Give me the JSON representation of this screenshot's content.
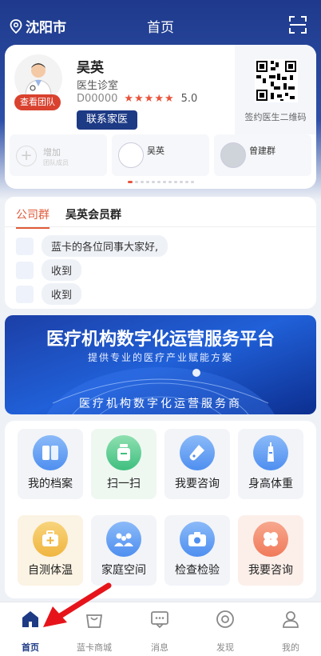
{
  "header": {
    "city": "沈阳市",
    "title": "首页"
  },
  "doctor": {
    "name": "吴英",
    "org": "医生诊室",
    "id": "D00000",
    "stars": "★★★★★",
    "rating": "5.0",
    "team_badge": "查看团队",
    "contact_button": "联系家医",
    "qr_label": "签约医生二维码"
  },
  "team": {
    "add_title": "增加",
    "add_sub": "团队成员",
    "members": [
      {
        "name": "吴英"
      },
      {
        "name": "曾建群"
      }
    ]
  },
  "groups": {
    "tabs": [
      "公司群",
      "吴英会员群"
    ],
    "messages": [
      "蓝卡的各位同事大家好,",
      "收到",
      "收到"
    ]
  },
  "banner": {
    "title": "医疗机构数字化运营服务平台",
    "subtitle": "提供专业的医疗产业赋能方案",
    "footer": "医疗机构数字化运营服务商"
  },
  "services": [
    {
      "label": "我的档案",
      "icon": "archive-icon",
      "color": "#4f8ff0"
    },
    {
      "label": "扫一扫",
      "icon": "scan-bottle-icon",
      "color": "#3fbf7f"
    },
    {
      "label": "我要咨询",
      "icon": "test-tube-icon",
      "color": "#4f8ff0"
    },
    {
      "label": "身高体重",
      "icon": "syringe-icon",
      "color": "#4f8ff0"
    },
    {
      "label": "自测体温",
      "icon": "medkit-icon",
      "color": "#f0b540"
    },
    {
      "label": "家庭空间",
      "icon": "family-icon",
      "color": "#4f8ff0"
    },
    {
      "label": "检查检验",
      "icon": "camera-icon",
      "color": "#4f8ff0"
    },
    {
      "label": "我要咨询",
      "icon": "clover-icon",
      "color": "#f07a5a"
    }
  ],
  "tabbar": [
    "首页",
    "蓝卡商城",
    "消息",
    "发现",
    "我的"
  ]
}
